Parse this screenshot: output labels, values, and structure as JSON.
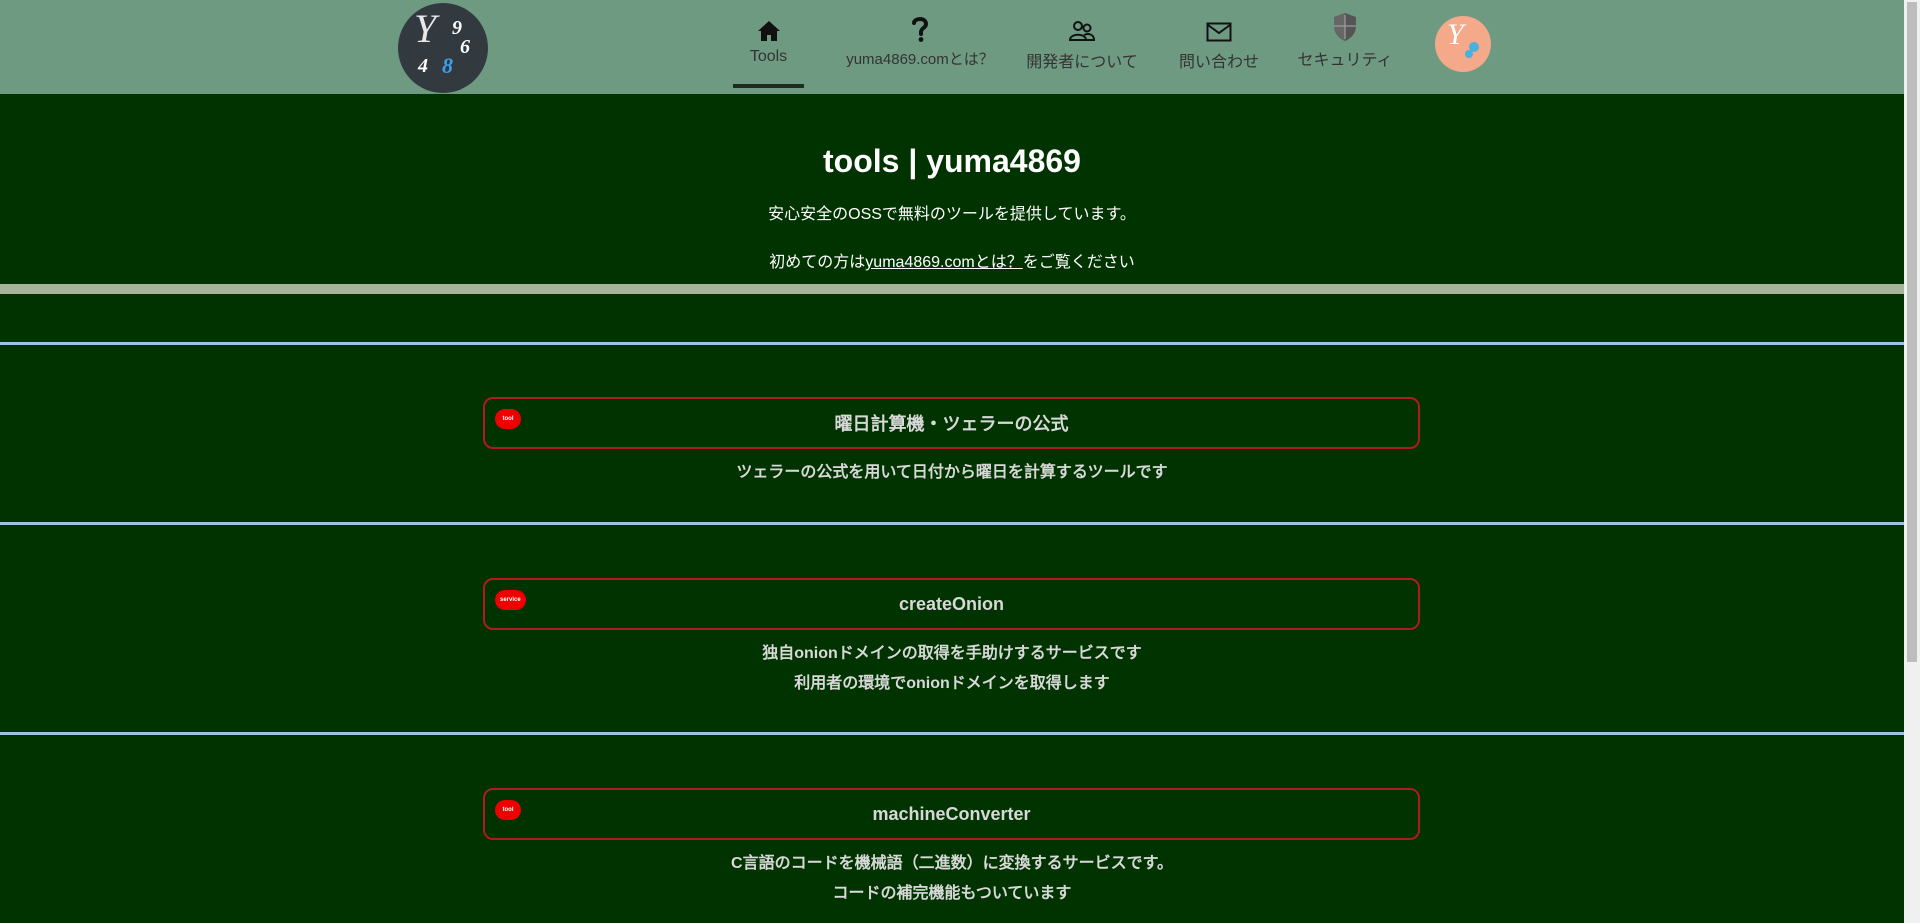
{
  "header": {
    "logo": {
      "y": "Y",
      "d9": "9",
      "d6": "6",
      "d4": "4",
      "d8": "8"
    },
    "nav": [
      {
        "label": "Tools",
        "icon": "home-icon"
      },
      {
        "label": "yuma4869.comとは？",
        "icon": "question-icon"
      },
      {
        "label": "開発者について",
        "icon": "people-icon"
      },
      {
        "label": "問い合わせ",
        "icon": "mail-icon"
      },
      {
        "label": "セキュリティ",
        "icon": "shield-icon"
      }
    ],
    "avatar": {
      "y": "Y"
    }
  },
  "hero": {
    "title": "tools | yuma4869",
    "subtitle": "安心安全のOSSで無料のツールを提供しています。",
    "note_prefix": "初めての方は",
    "note_link": "yuma4869.comとは？",
    "note_suffix": "をご覧ください"
  },
  "cards": [
    {
      "badge": "tool",
      "title": "曜日計算機・ツェラーの公式",
      "desc": [
        "ツェラーの公式を用いて日付から曜日を計算するツールです"
      ]
    },
    {
      "badge": "service",
      "title": "createOnion",
      "desc": [
        "独自onionドメインの取得を手助けするサービスです",
        "利用者の環境でonionドメインを取得します"
      ]
    },
    {
      "badge": "tool",
      "title": "machineConverter",
      "desc": [
        "C言語のコードを機械語（二進数）に変換するサービスです。",
        "コードの補完機能もついています"
      ]
    }
  ],
  "colors": {
    "header_bg": "#6f9a82",
    "page_bg": "#003300",
    "card_border": "#b01c1c",
    "badge_bg": "#ee0000",
    "separator": "#9fc0e0"
  }
}
